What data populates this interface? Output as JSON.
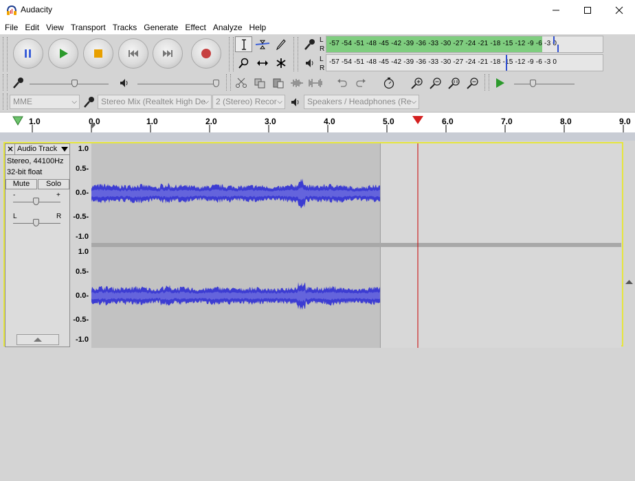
{
  "window": {
    "title": "Audacity"
  },
  "menu": [
    "File",
    "Edit",
    "View",
    "Transport",
    "Tracks",
    "Generate",
    "Effect",
    "Analyze",
    "Help"
  ],
  "meters": {
    "channel_labels": [
      "L",
      "R"
    ],
    "scale": "-57 -54 -51 -48 -45 -42 -39 -36 -33 -30 -27 -24 -21 -18 -15 -12  -9  -6  -3  0",
    "record_level": 0.78,
    "playback_level": 0
  },
  "devices": {
    "host": "MME",
    "input": "Stereo Mix (Realtek High De",
    "channels": "2 (Stereo) Recor",
    "output": "Speakers / Headphones (Re"
  },
  "timeline": {
    "labels": [
      "1.0",
      "0.0",
      "1.0",
      "2.0",
      "3.0",
      "4.0",
      "5.0",
      "6.0",
      "7.0",
      "8.0",
      "9.0"
    ],
    "playhead_seconds": 5.5
  },
  "track": {
    "name": "Audio Track",
    "info_line1": "Stereo, 44100Hz",
    "info_line2": "32-bit float",
    "mute_label": "Mute",
    "solo_label": "Solo",
    "gain_minus": "-",
    "gain_plus": "+",
    "pan_left": "L",
    "pan_right": "R",
    "amplitude_labels": [
      "1.0",
      "0.5-",
      "0.0-",
      "-0.5-",
      "-1.0"
    ],
    "audio_end_seconds": 4.9
  },
  "colors": {
    "waveform": "#3c3cd2",
    "waveform_light": "#6464dc",
    "selection": "#c2c2c2",
    "playhead": "#c80000",
    "meter_green": "#7fcd7f"
  }
}
